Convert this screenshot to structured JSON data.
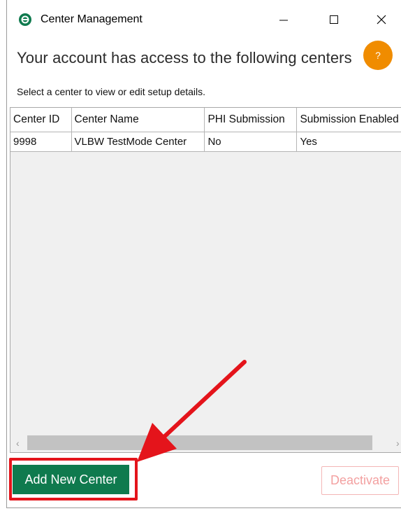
{
  "window": {
    "title": "Center Management"
  },
  "header": {
    "heading": "Your account has access to the following centers",
    "help_label": "?",
    "subtext": "Select a center to view or edit setup details."
  },
  "table": {
    "columns": [
      "Center ID",
      "Center Name",
      "PHI Submission",
      "Submission Enabled"
    ],
    "rows": [
      [
        "9998",
        "VLBW TestMode Center",
        "No",
        "Yes"
      ]
    ]
  },
  "actions": {
    "add_label": "Add New Center",
    "deactivate_label": "Deactivate"
  },
  "colors": {
    "accent_green": "#0f7a4e",
    "help_orange": "#f08c00",
    "annotation_red": "#e4141b",
    "deactivate_text": "#f3a0a0"
  }
}
